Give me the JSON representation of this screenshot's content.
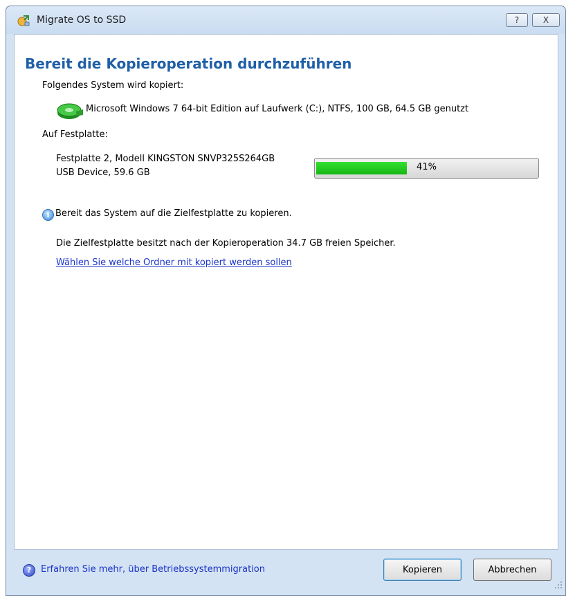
{
  "window": {
    "title": "Migrate OS to SSD",
    "help_button": "?",
    "close_button": "X"
  },
  "main": {
    "heading": "Bereit die Kopieroperation durchzuführen",
    "source_label": "Folgendes System wird kopiert:",
    "source_value": "Microsoft Windows 7 64-bit Edition auf Laufwerk (C:), NTFS, 100 GB, 64.5 GB genutzt",
    "target_label": "Auf Festplatte:",
    "target_line1": "Festplatte 2, Modell KINGSTON  SNVP325S264GB",
    "target_line2": "USB Device, 59.6 GB",
    "progress": {
      "percent": 41,
      "label": "41%"
    },
    "info_text": "Bereit das System auf die Zielfestplatte zu kopieren.",
    "free_space_text": "Die Zielfestplatte besitzt nach der Kopieroperation 34.7 GB freien Speicher.",
    "choose_folders_link": "Wählen Sie welche Ordner mit kopiert werden sollen"
  },
  "footer": {
    "help_link": "Erfahren Sie mehr, über Betriebssystemmigration",
    "primary_button": "Kopieren",
    "cancel_button": "Abbrechen"
  },
  "colors": {
    "heading": "#1f5fa8",
    "link": "#1a33c7",
    "progress_fill": "#22c422"
  },
  "icons": [
    "migrate-app-icon",
    "disk-icon",
    "info-icon",
    "help-icon",
    "resize-grip-icon"
  ]
}
